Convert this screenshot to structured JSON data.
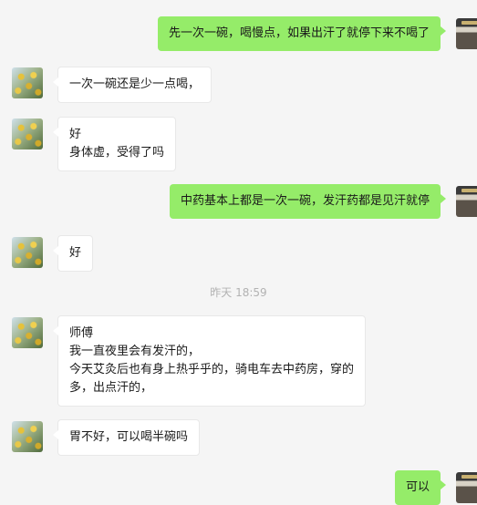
{
  "messages": [
    {
      "side": "right",
      "lines": [
        "先一次一碗，喝慢点，如果出汗了就停下来不喝了"
      ]
    },
    {
      "side": "left",
      "lines": [
        "一次一碗还是少一点喝，"
      ]
    },
    {
      "side": "left",
      "lines": [
        "好",
        "身体虚，受得了吗"
      ]
    },
    {
      "side": "right",
      "lines": [
        "中药基本上都是一次一碗，发汗药都是见汗就停"
      ]
    },
    {
      "side": "left",
      "lines": [
        "好"
      ]
    },
    {
      "side": "left",
      "lines": [
        "师傅",
        "我一直夜里会有发汗的，",
        "今天艾灸后也有身上热乎乎的，骑电车去中药房，穿的",
        "多，出点汗的，"
      ]
    },
    {
      "side": "left",
      "lines": [
        "胃不好，可以喝半碗吗"
      ]
    },
    {
      "side": "right",
      "lines": [
        "可以"
      ]
    }
  ],
  "timestamp": "昨天 18:59"
}
